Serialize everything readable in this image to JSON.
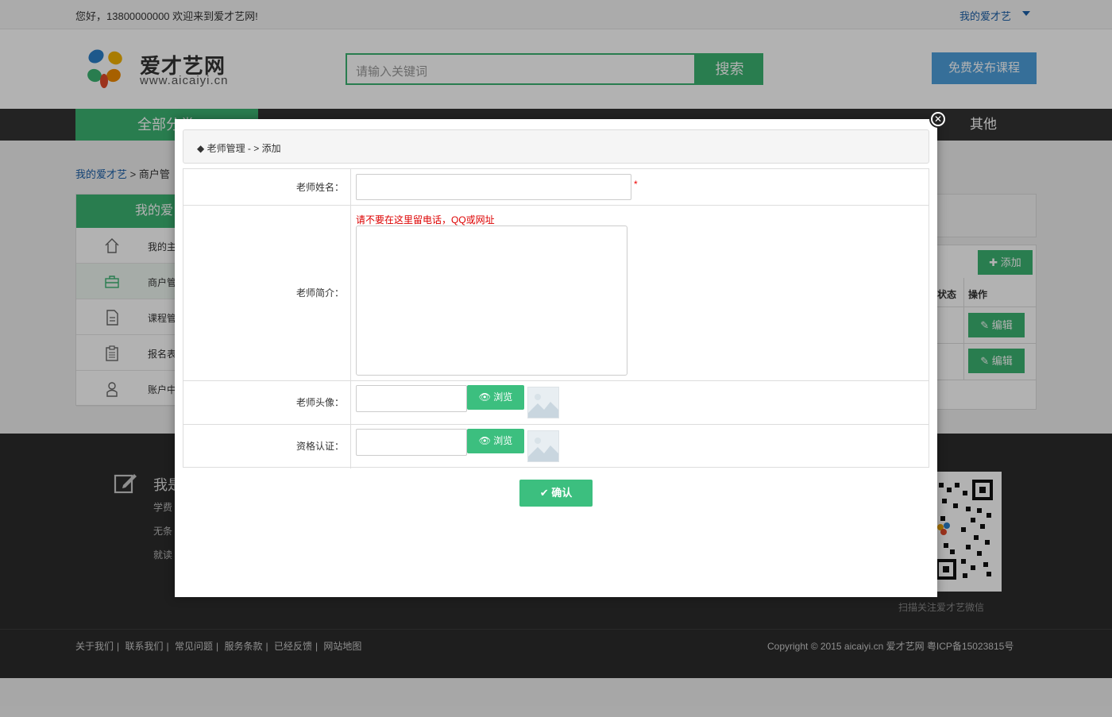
{
  "topbar": {
    "greeting": "您好，13800000000 欢迎来到爱才艺网!",
    "my_account": "我的爱才艺"
  },
  "brand": {
    "name": "爱才艺网",
    "url": "www.aicaiyi.cn"
  },
  "search": {
    "placeholder": "请输入关键词",
    "button": "搜索"
  },
  "publish_button": "免费发布课程",
  "nav": {
    "all_categories": "全部分类",
    "other": "其他"
  },
  "breadcrumb": {
    "home": "我的爱才艺",
    "sep": " > ",
    "current": "商户管"
  },
  "sidebar": {
    "title": "我的爱",
    "items": [
      {
        "label": "我的主",
        "icon": "home-icon"
      },
      {
        "label": "商户管",
        "icon": "briefcase-icon"
      },
      {
        "label": "课程管",
        "icon": "document-icon"
      },
      {
        "label": "报名表",
        "icon": "clipboard-icon"
      },
      {
        "label": "账户中心",
        "icon": "user-icon"
      }
    ]
  },
  "table": {
    "add_button": "添加",
    "col_status": "状态",
    "col_op": "操作",
    "edit_button": "编辑"
  },
  "footer": {
    "title": "我是",
    "lines": [
      "学费",
      "无条",
      "就读"
    ],
    "qr_caption": "扫描关注爱才艺微信",
    "links": [
      "关于我们",
      "联系我们",
      "常见问题",
      "服务条款",
      "已经反馈",
      "网站地图"
    ],
    "copyright": "Copyright © 2015 aicaiyi.cn 爱才艺网 粤ICP备15023815号"
  },
  "modal": {
    "breadcrumb": "老师管理 - > 添加",
    "close_icon": "close-icon",
    "fields": {
      "name_label": "老师姓名：",
      "name_required": "*",
      "intro_label": "老师简介：",
      "intro_warning": "请不要在这里留电话，QQ或网址",
      "avatar_label": "老师头像：",
      "cert_label": "资格认证：",
      "browse_button": "浏览"
    },
    "confirm_button": "确认"
  },
  "colors": {
    "green": "#3cb371",
    "blue": "#4ea0dc",
    "link": "#1a5fa8",
    "dark": "#333333"
  }
}
